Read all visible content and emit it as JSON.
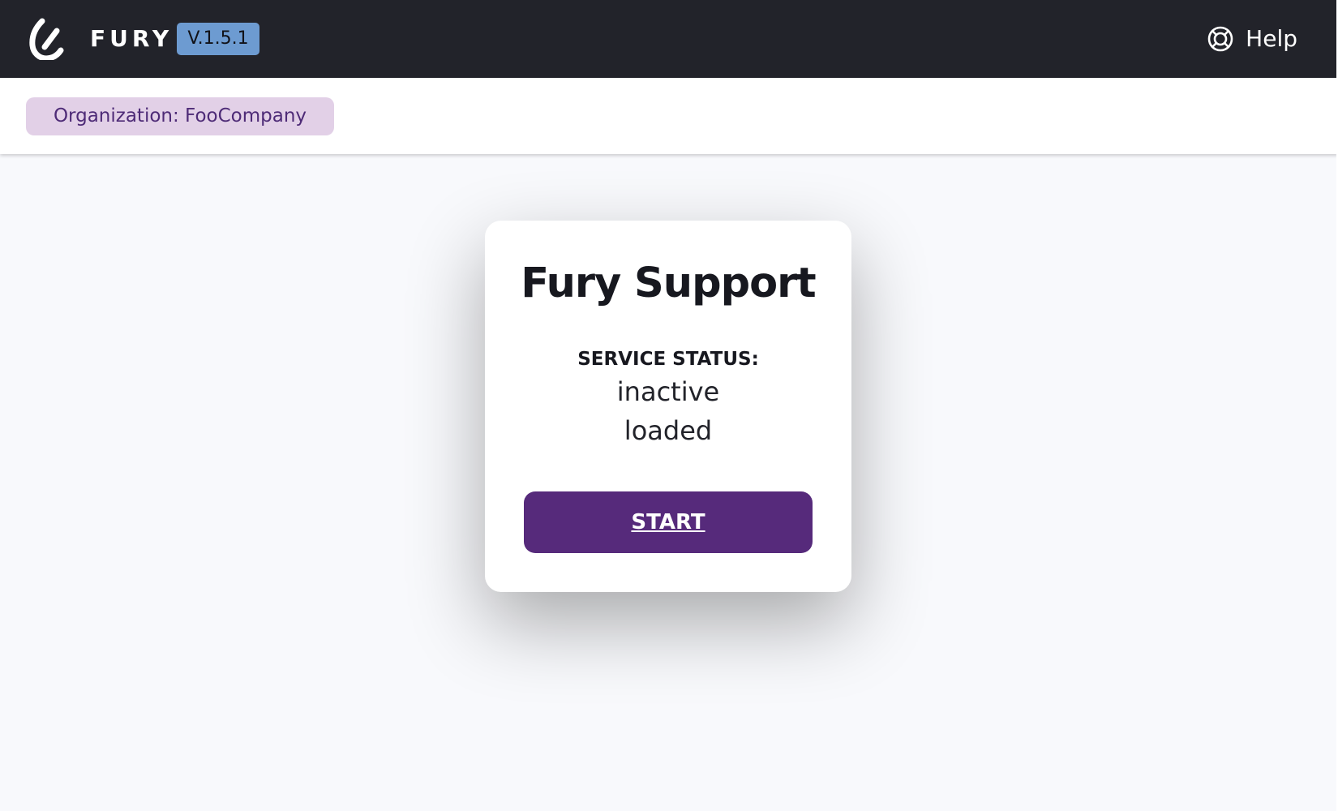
{
  "header": {
    "app_name": "FURY",
    "version": "V.1.5.1",
    "logo_icon": "fury-logo-icon",
    "help_label": "Help",
    "help_icon": "lifebuoy-icon",
    "colors": {
      "header_background": "#22232a",
      "version_badge": "#6d9bd1"
    }
  },
  "organization": {
    "label": "Organization: FooCompany",
    "colors": {
      "background": "#e2d0e7",
      "text": "#4e2b77"
    }
  },
  "support_card": {
    "title": "Fury Support",
    "status_heading": "SERVICE STATUS:",
    "status_values": [
      "inactive",
      "loaded"
    ],
    "start_button_label": "START",
    "colors": {
      "card_background": "#ffffff",
      "start_button": "#562a7b"
    }
  }
}
